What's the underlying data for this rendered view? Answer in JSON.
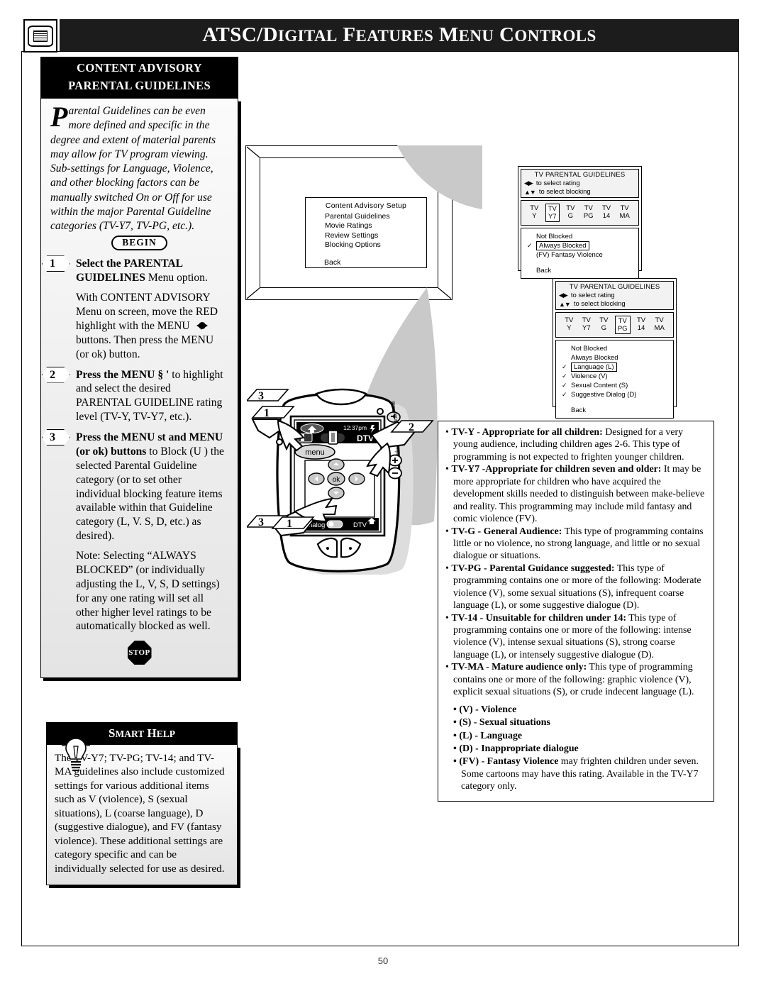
{
  "header": {
    "icon": "tv-screen-icon",
    "title_main": "ATSC/D",
    "title": "ATSC/DIGITAL FEATURES MENU CONTROLS",
    "title_parts": [
      "ATSC/D",
      "IGITAL",
      " F",
      "EATURES",
      " M",
      "ENU",
      " C",
      "ONTROLS"
    ]
  },
  "procedure": {
    "header_line1": "CONTENT ADVISORY",
    "header_line2": "PARENTAL GUIDELINES",
    "intro_dropcap": "P",
    "intro": "arental Guidelines can be even more defined and specific in the degree and extent of material parents may allow for TV program viewing. Sub-settings for Language, Violence, and other blocking factors can be manually switched On or Off for use within the major Parental Guideline categories (TV-Y7, TV-PG, etc.).",
    "begin_badge": "BEGIN",
    "stop_badge": "STOP",
    "steps": [
      {
        "num": "1",
        "bold": "Select the PARENTAL GUIDELINES",
        "rest": " Menu option.",
        "body_a": "With CONTENT ADVISORY Menu on screen, move the RED highlight with the MENU ",
        "body_b": " buttons. Then press the MENU (or ok) button."
      },
      {
        "num": "2",
        "bold": "Press the MENU § '",
        "rest": "  to highlight and select the desired PARENTAL GUIDELINE rating level (TV-Y, TV-Y7, etc.)."
      },
      {
        "num": "3",
        "bold": "Press the MENU st",
        "bold2": "and MENU (or ok) buttons",
        "rest": " to Block (U ) the selected Parental Guideline category (or to set other individual  blocking feature items available within that Guideline category (L, V. S, D, etc.) as desired).",
        "note": "Note: Selecting “ALWAYS BLOCKED” (or individually adjusting the L, V, S, D settings) for any one rating will set all other higher level ratings to be automatically blocked as well."
      }
    ]
  },
  "smart_help": {
    "title": "SMART HELP",
    "icon": "lightbulb-icon",
    "text": "The TV-Y7; TV-PG; TV-14; and TV-MA guidelines also include customized settings for various additional items such as V (violence), S (sexual situations), L (coarse language), D (suggestive dialogue), and FV (fantasy violence). These additional settings are category specific and can be individually selected for use as desired."
  },
  "tv_osd": {
    "title": "Content Advisory Setup",
    "items": [
      "Parental Guidelines",
      "Movie Ratings",
      "Review Settings",
      "Blocking Options"
    ],
    "selected": "Parental Guidelines",
    "back": "Back"
  },
  "osd_panels": [
    {
      "title": "TV PARENTAL GUIDELINES",
      "hint_rating": "to select rating",
      "hint_blocking": "to select blocking",
      "ratings_top": [
        "TV",
        "TV",
        "TV",
        "TV",
        "TV",
        "TV"
      ],
      "ratings_bottom": [
        "Y",
        "Y7",
        "G",
        "PG",
        "14",
        "MA"
      ],
      "selected_index": 1,
      "options": [
        {
          "label": "Not Blocked",
          "checked": false,
          "boxed": false
        },
        {
          "label": "Always Blocked",
          "checked": true,
          "boxed": true
        },
        {
          "label": "(FV) Fantasy Violence",
          "checked": false,
          "boxed": false
        }
      ],
      "back": "Back"
    },
    {
      "title": "TV PARENTAL GUIDELINES",
      "hint_rating": "to select rating",
      "hint_blocking": "to select blocking",
      "ratings_top": [
        "TV",
        "TV",
        "TV",
        "TV",
        "TV",
        "TV"
      ],
      "ratings_bottom": [
        "Y",
        "Y7",
        "G",
        "PG",
        "14",
        "MA"
      ],
      "selected_index": 3,
      "options": [
        {
          "label": "Not Blocked",
          "checked": false,
          "boxed": false
        },
        {
          "label": "Always Blocked",
          "checked": false,
          "boxed": false
        },
        {
          "label": "Language (L)",
          "checked": true,
          "boxed": true
        },
        {
          "label": "Violence (V)",
          "checked": true,
          "boxed": false
        },
        {
          "label": "Sexual Content (S)",
          "checked": true,
          "boxed": false
        },
        {
          "label": "Suggestive Dialog (D)",
          "checked": true,
          "boxed": false
        }
      ],
      "back": "Back"
    }
  ],
  "remote": {
    "time": "12:37pm",
    "source": "DTV",
    "menu_label": "menu",
    "ok_label": "ok",
    "analog_label": "analog",
    "dtv_label": "DTV",
    "side_labels": [
      "mute",
      "channel",
      "volume"
    ],
    "callouts": [
      "3",
      "1",
      "2",
      "3",
      "1"
    ]
  },
  "descriptions": {
    "items": [
      {
        "bold": "TV-Y - Appropriate for all children:",
        "text": " Designed for a very young audience, including children ages 2-6. This type of programming is not expected to frighten younger children."
      },
      {
        "bold": "TV-Y7 -Appropriate for children seven and older:",
        "text": " It may be more appropriate for children who have acquired the development skills needed to distinguish between make-believe and reality. This programming may include mild fantasy and comic violence (FV)."
      },
      {
        "bold": "TV-G - General Audience:",
        "text": " This type of programming contains little or no violence, no strong language, and little or no sexual dialogue or situations."
      },
      {
        "bold": "TV-PG - Parental Guidance suggested:",
        "text": " This type of programming contains one or more of the following: Moderate violence (V), some sexual situations (S), infrequent coarse language (L), or some suggestive dialogue (D)."
      },
      {
        "bold": "TV-14 - Unsuitable for children under 14:",
        "text": " This type of programming contains one or more of the following: intense violence (V), intense sexual situations (S), strong coarse language (L), or intensely suggestive dialogue (D)."
      },
      {
        "bold": "TV-MA - Mature audience only:",
        "text": " This type of programming contains one or more of the following: graphic violence (V), explicit sexual situations (S), or crude indecent language (L)."
      }
    ],
    "abbrev": [
      {
        "bold": "(V) - Violence",
        "text": ""
      },
      {
        "bold": "(S) - Sexual situations",
        "text": ""
      },
      {
        "bold": "(L) - Language",
        "text": ""
      },
      {
        "bold": "(D) - Inappropriate dialogue",
        "text": ""
      },
      {
        "bold": "(FV) - Fantasy Violence",
        "text": " may frighten children under seven. Some cartoons may have this rating. Available in the TV-Y7 category only."
      }
    ]
  },
  "page_number": "50",
  "colors": {
    "ink": "#000000",
    "panel_gray": "#c9c9c9",
    "box_fill": "#f2f2f2"
  }
}
